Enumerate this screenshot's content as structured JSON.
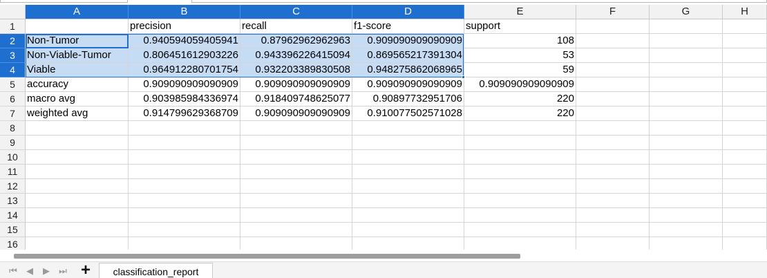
{
  "columns": [
    "A",
    "B",
    "C",
    "D",
    "E",
    "F",
    "G",
    "H"
  ],
  "selected_columns": [
    "A",
    "B",
    "C",
    "D"
  ],
  "rows": [
    {
      "num": "1",
      "cells": [
        "",
        "precision",
        "recall",
        "f1-score",
        "support",
        "",
        "",
        ""
      ]
    },
    {
      "num": "2",
      "cells": [
        "Non-Tumor",
        "0.940594059405941",
        "0.87962962962963",
        "0.909090909090909",
        "108",
        "",
        "",
        ""
      ]
    },
    {
      "num": "3",
      "cells": [
        "Non-Viable-Tumor",
        "0.806451612903226",
        "0.943396226415094",
        "0.869565217391304",
        "53",
        "",
        "",
        ""
      ]
    },
    {
      "num": "4",
      "cells": [
        "Viable",
        "0.964912280701754",
        "0.932203389830508",
        "0.948275862068965",
        "59",
        "",
        "",
        ""
      ]
    },
    {
      "num": "5",
      "cells": [
        "accuracy",
        "0.909090909090909",
        "0.909090909090909",
        "0.909090909090909",
        "0.909090909090909",
        "",
        "",
        ""
      ]
    },
    {
      "num": "6",
      "cells": [
        "macro avg",
        "0.903985984336974",
        "0.918409748625077",
        "0.90897732951706",
        "220",
        "",
        "",
        ""
      ]
    },
    {
      "num": "7",
      "cells": [
        "weighted avg",
        "0.914799629368709",
        "0.909090909090909",
        "0.910077502571028",
        "220",
        "",
        "",
        ""
      ]
    },
    {
      "num": "8",
      "cells": [
        "",
        "",
        "",
        "",
        "",
        "",
        "",
        ""
      ]
    },
    {
      "num": "9",
      "cells": [
        "",
        "",
        "",
        "",
        "",
        "",
        "",
        ""
      ]
    },
    {
      "num": "10",
      "cells": [
        "",
        "",
        "",
        "",
        "",
        "",
        "",
        ""
      ]
    },
    {
      "num": "11",
      "cells": [
        "",
        "",
        "",
        "",
        "",
        "",
        "",
        ""
      ]
    },
    {
      "num": "12",
      "cells": [
        "",
        "",
        "",
        "",
        "",
        "",
        "",
        ""
      ]
    },
    {
      "num": "13",
      "cells": [
        "",
        "",
        "",
        "",
        "",
        "",
        "",
        ""
      ]
    },
    {
      "num": "14",
      "cells": [
        "",
        "",
        "",
        "",
        "",
        "",
        "",
        ""
      ]
    },
    {
      "num": "15",
      "cells": [
        "",
        "",
        "",
        "",
        "",
        "",
        "",
        ""
      ]
    },
    {
      "num": "16",
      "cells": [
        "",
        "",
        "",
        "",
        "",
        "",
        "",
        ""
      ]
    }
  ],
  "selected_rows": [
    "2",
    "3",
    "4"
  ],
  "sheet_tab": {
    "label": "classification_report"
  },
  "nav_icons": [
    "first-sheet-icon",
    "prev-sheet-icon",
    "next-sheet-icon",
    "last-sheet-icon"
  ],
  "add_icon": "plus-icon",
  "colors": {
    "selection_accent": "#1f6fd1",
    "selection_fill": "#c6dcf4"
  }
}
